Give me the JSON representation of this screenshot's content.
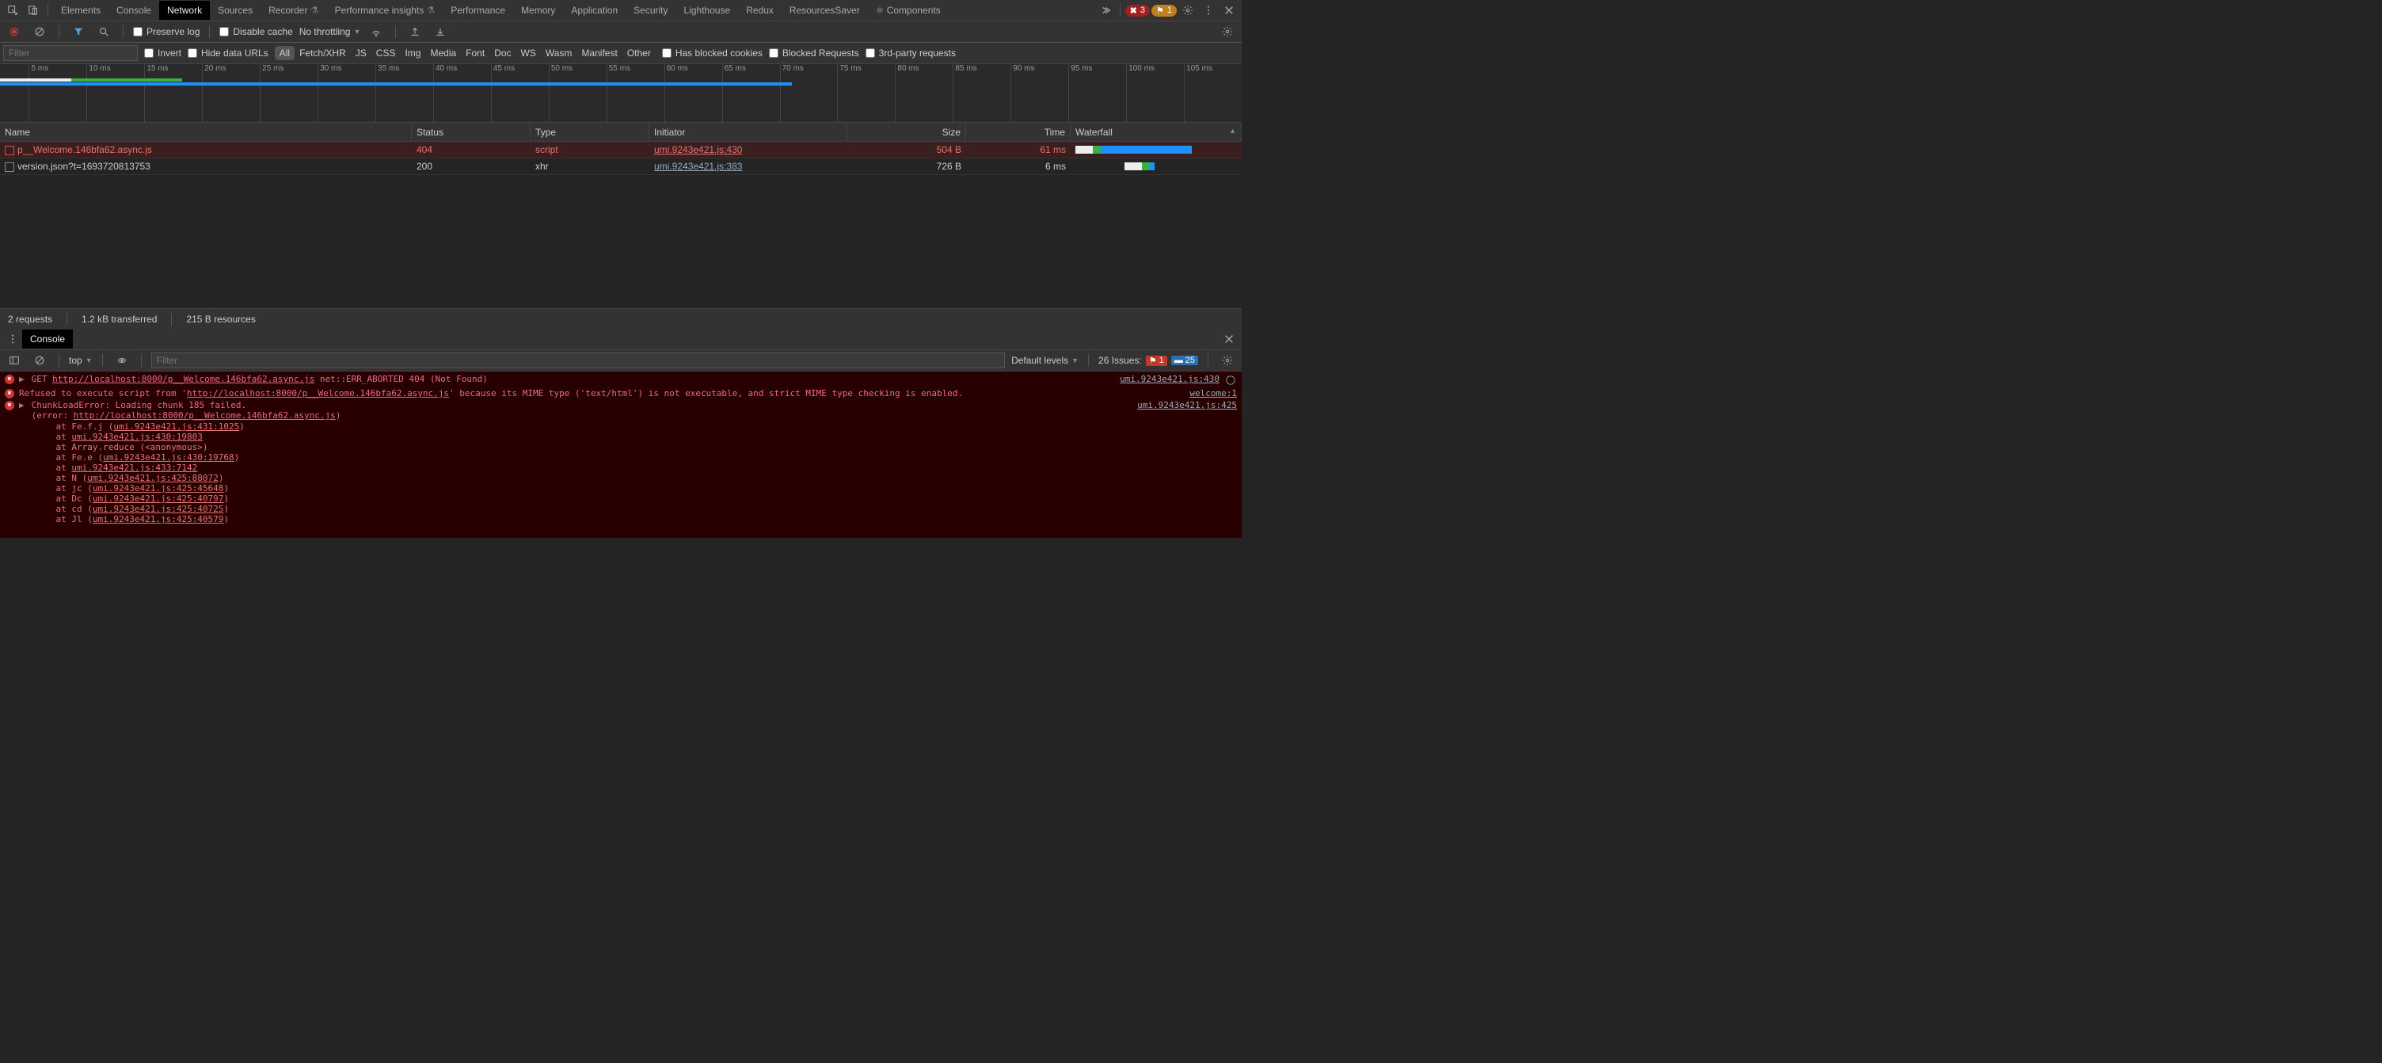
{
  "tabs": {
    "items": [
      "Elements",
      "Console",
      "Network",
      "Sources",
      "Recorder",
      "Performance insights",
      "Performance",
      "Memory",
      "Application",
      "Security",
      "Lighthouse",
      "Redux",
      "ResourcesSaver",
      "Components"
    ],
    "active": "Network"
  },
  "topRight": {
    "errCount": "3",
    "warnCount": "1"
  },
  "networkToolbar": {
    "preserveLog": "Preserve log",
    "disableCache": "Disable cache",
    "throttling": "No throttling"
  },
  "filterBar": {
    "filterPlaceholder": "Filter",
    "invert": "Invert",
    "hideDataUrls": "Hide data URLs",
    "types": [
      "All",
      "Fetch/XHR",
      "JS",
      "CSS",
      "Img",
      "Media",
      "Font",
      "Doc",
      "WS",
      "Wasm",
      "Manifest",
      "Other"
    ],
    "activeType": "All",
    "hasBlockedCookies": "Has blocked cookies",
    "blockedRequests": "Blocked Requests",
    "thirdParty": "3rd-party requests"
  },
  "timeline": {
    "ticks": [
      "5 ms",
      "10 ms",
      "15 ms",
      "20 ms",
      "25 ms",
      "30 ms",
      "35 ms",
      "40 ms",
      "45 ms",
      "50 ms",
      "55 ms",
      "60 ms",
      "65 ms",
      "70 ms",
      "75 ms",
      "80 ms",
      "85 ms",
      "90 ms",
      "95 ms",
      "100 ms",
      "105 ms"
    ]
  },
  "tableHeaders": {
    "name": "Name",
    "status": "Status",
    "type": "Type",
    "initiator": "Initiator",
    "size": "Size",
    "time": "Time",
    "waterfall": "Waterfall"
  },
  "rows": [
    {
      "name": "p__Welcome.146bfa62.async.js",
      "status": "404",
      "type": "script",
      "initiator": "umi.9243e421.js:430",
      "size": "504 B",
      "time": "61 ms",
      "error": true
    },
    {
      "name": "version.json?t=1693720813753",
      "status": "200",
      "type": "xhr",
      "initiator": "umi.9243e421.js:383",
      "size": "726 B",
      "time": "6 ms",
      "error": false
    }
  ],
  "statusBar": {
    "requests": "2 requests",
    "transferred": "1.2 kB transferred",
    "resources": "215 B resources"
  },
  "drawer": {
    "tab": "Console"
  },
  "consoleToolbar": {
    "context": "top",
    "filterPlaceholder": "Filter",
    "levels": "Default levels",
    "issuesLabel": "26 Issues:",
    "issuesRed": "1",
    "issuesBlue": "25"
  },
  "consoleMessages": {
    "m1": {
      "method": "GET",
      "url": "http://localhost:8000/p__Welcome.146bfa62.async.js",
      "suffix": "net::ERR_ABORTED 404 (Not Found)",
      "src": "umi.9243e421.js:430"
    },
    "m2": {
      "prefix": "Refused to execute script from '",
      "url": "http://localhost:8000/p__Welcome.146bfa62.async.js",
      "suffix": "' because its MIME type ('text/html') is not executable, and strict MIME type checking is enabled.",
      "src": "welcome:1"
    },
    "m3": {
      "line1": "ChunkLoadError: Loading chunk 185 failed.",
      "line2a": "(error: ",
      "line2url": "http://localhost:8000/p__Welcome.146bfa62.async.js",
      "line2b": ")",
      "src": "umi.9243e421.js:425",
      "stack": [
        "    at Fe.f.j (umi.9243e421.js:431:1025)",
        "    at umi.9243e421.js:430:19803",
        "    at Array.reduce (<anonymous>)",
        "    at Fe.e (umi.9243e421.js:430:19768)",
        "    at umi.9243e421.js:433:7142",
        "    at N (umi.9243e421.js:425:88072)",
        "    at jc (umi.9243e421.js:425:45648)",
        "    at Dc (umi.9243e421.js:425:40797)",
        "    at cd (umi.9243e421.js:425:40725)",
        "    at Jl (umi.9243e421.js:425:40579)"
      ],
      "stackLinks": [
        "umi.9243e421.js:431:1025",
        "umi.9243e421.js:430:19803",
        "",
        "umi.9243e421.js:430:19768",
        "umi.9243e421.js:433:7142",
        "umi.9243e421.js:425:88072",
        "umi.9243e421.js:425:45648",
        "umi.9243e421.js:425:40797",
        "umi.9243e421.js:425:40725",
        "umi.9243e421.js:425:40579"
      ]
    }
  }
}
